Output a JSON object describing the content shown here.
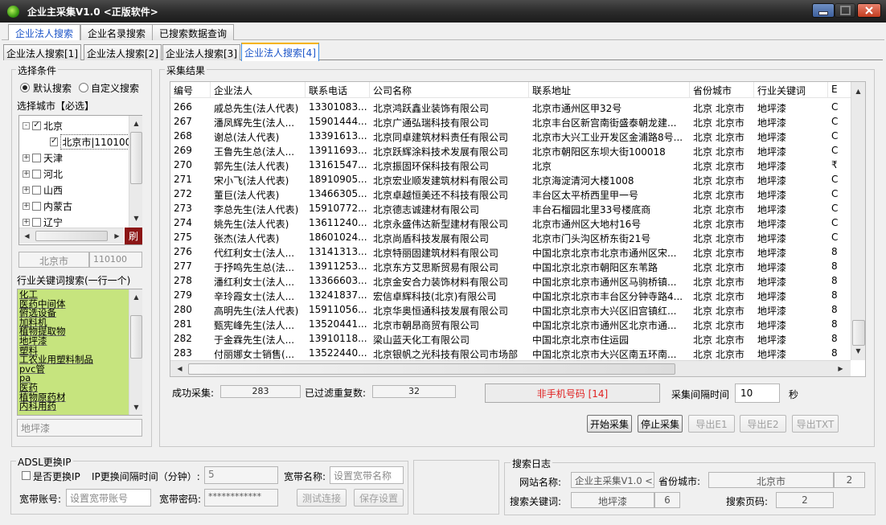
{
  "window": {
    "title": "企业主采集V1.0 <正版软件>"
  },
  "top_tabs": [
    "企业法人搜索",
    "企业名录搜索",
    "已搜索数据查询"
  ],
  "sub_tabs": [
    "企业法人搜索[1]",
    "企业法人搜索[2]",
    "企业法人搜索[3]",
    "企业法人搜索[4]"
  ],
  "conditions": {
    "group_title": "选择条件",
    "mode_default": "默认搜索",
    "mode_custom": "自定义搜索",
    "city_label": "选择城市【必选】",
    "tree": [
      {
        "label": "北京",
        "expander": "-",
        "checked": true,
        "child": false
      },
      {
        "label": "北京市|110100",
        "expander": "",
        "checked": true,
        "child": true
      },
      {
        "label": "天津",
        "expander": "+",
        "checked": false,
        "child": false
      },
      {
        "label": "河北",
        "expander": "+",
        "checked": false,
        "child": false
      },
      {
        "label": "山西",
        "expander": "+",
        "checked": false,
        "child": false
      },
      {
        "label": "内蒙古",
        "expander": "+",
        "checked": false,
        "child": false
      },
      {
        "label": "辽宁",
        "expander": "+",
        "checked": false,
        "child": false
      }
    ],
    "refresh_label": "刷",
    "selected_city": "北京市",
    "selected_code": "110100",
    "keyword_label": "行业关键词搜索(一行一个)",
    "keywords": [
      "化工",
      "医药中间体",
      "俯选设备",
      "加料机",
      "植物提取物",
      "地坪漆",
      "塑料",
      "工农业用塑料制品",
      "pvc管",
      "pa",
      "医药",
      "植物原药材",
      "内科用药"
    ],
    "keyword_input": "地坪漆"
  },
  "results": {
    "group_title": "采集结果",
    "columns": [
      "编号",
      "企业法人",
      "联系电话",
      "公司名称",
      "联系地址",
      "省份城市",
      "行业关键词",
      "E"
    ],
    "rows": [
      [
        "266",
        "戚总先生(法人代表)",
        "13301083...",
        "北京鸿跃鑫业装饰有限公司",
        "北京市通州区甲32号",
        "北京 北京市",
        "地坪漆",
        "C"
      ],
      [
        "267",
        "潘凤辉先生(法人...",
        "15901444...",
        "北京广通弘瑞科技有限公司",
        "北京丰台区新宫南街盛泰朝龙建...",
        "北京 北京市",
        "地坪漆",
        "C"
      ],
      [
        "268",
        "谢总(法人代表)",
        "13391613...",
        "北京同卓建筑材料责任有限公司",
        "北京市大兴工业开发区金浦路8号...",
        "北京 北京市",
        "地坪漆",
        "C"
      ],
      [
        "269",
        "王鲁先生总(法人...",
        "13911693...",
        "北京跃辉涂料技术发展有限公司",
        "北京市朝阳区东坝大街100018",
        "北京 北京市",
        "地坪漆",
        "C"
      ],
      [
        "270",
        "郭先生(法人代表)",
        "13161547...",
        "北京振固环保科技有限公司",
        "北京",
        "北京 北京市",
        "地坪漆",
        "₹"
      ],
      [
        "271",
        "宋小飞(法人代表)",
        "18910905...",
        "北京宏业顺发建筑材料有限公司",
        "北京海淀清河大楼1008",
        "北京 北京市",
        "地坪漆",
        "C"
      ],
      [
        "272",
        "董巨(法人代表)",
        "13466305...",
        "北京卓越恒美还不科技有限公司",
        "丰台区太平桥西里甲一号",
        "北京 北京市",
        "地坪漆",
        "C"
      ],
      [
        "273",
        "李总先生(法人代表)",
        "15910772...",
        "北京德志诚建材有限公司",
        "丰台石榴园北里33号楼底商",
        "北京 北京市",
        "地坪漆",
        "C"
      ],
      [
        "274",
        "姚先生(法人代表)",
        "13611240...",
        "北京永盛伟达新型建材有限公司",
        "北京市通州区大地村16号",
        "北京 北京市",
        "地坪漆",
        "C"
      ],
      [
        "275",
        "张杰(法人代表)",
        "18601024...",
        "北京尚盾科技发展有限公司",
        "北京市门头沟区桥东街21号",
        "北京 北京市",
        "地坪漆",
        "C"
      ],
      [
        "276",
        "代红利女士(法人...",
        "13141313...",
        "北京特丽固建筑材料有限公司",
        "中国北京北京市北京市通州区宋...",
        "北京 北京市",
        "地坪漆",
        "8"
      ],
      [
        "277",
        "于抒鸣先生总(法...",
        "13911253...",
        "北京东方艾思斯贸易有限公司",
        "中国北京北京市朝阳区东苇路",
        "北京 北京市",
        "地坪漆",
        "8"
      ],
      [
        "278",
        "潘红利女士(法人...",
        "13366603...",
        "北京金安合力装饰材料有限公司",
        "中国北京北京市通州区马驹桥镇...",
        "北京 北京市",
        "地坪漆",
        "8"
      ],
      [
        "279",
        "辛玲霞女士(法人...",
        "13241837...",
        "宏信卓辉科技(北京)有限公司",
        "中国北京北京市丰台区分钟寺路4...",
        "北京 北京市",
        "地坪漆",
        "8"
      ],
      [
        "280",
        "高明先生(法人代表)",
        "15911056...",
        "北京华奥恒通科技发展有限公司",
        "中国北京北京市大兴区旧宫镇红...",
        "北京 北京市",
        "地坪漆",
        "8"
      ],
      [
        "281",
        "甄宪峰先生(法人...",
        "13520441...",
        "北京市朝昂商贸有限公司",
        "中国北京北京市通州区北京市通...",
        "北京 北京市",
        "地坪漆",
        "8"
      ],
      [
        "282",
        "于金霖先生(法人...",
        "13910118...",
        "梁山蓝天化工有限公司",
        "中国北京北京市住运园",
        "北京 北京市",
        "地坪漆",
        "8"
      ],
      [
        "283",
        "付丽娜女士销售(...",
        "13522440...",
        "北京银帆之光科技有限公司市场部",
        "中国北京北京市大兴区南五环南...",
        "北京 北京市",
        "地坪漆",
        "8"
      ]
    ]
  },
  "stats": {
    "success_label": "成功采集:",
    "success_count": "283",
    "filtered_label": "已过滤重复数:",
    "filtered_count": "32",
    "nonmobile": "非手机号码 [14]",
    "interval_label": "采集间隔时间",
    "interval_value": "10",
    "interval_unit": "秒"
  },
  "actions": {
    "start": "开始采集",
    "stop": "停止采集",
    "export1": "导出E1",
    "export2": "导出E2",
    "export_txt": "导出TXT"
  },
  "adsl": {
    "group_title": "ADSL更换IP",
    "change_ip_label": "是否更换IP",
    "interval_label": "IP更换间隔时间（分钟）:",
    "interval_value": "5",
    "bb_name_label": "宽带名称:",
    "bb_name_placeholder": "设置宽带名称",
    "bb_account_label": "宽带账号:",
    "bb_account_placeholder": "设置宽带账号",
    "bb_password_label": "宽带密码:",
    "bb_password_value": "************",
    "test_button": "测试连接",
    "save_button": "保存设置"
  },
  "log": {
    "group_title": "搜索日志",
    "site_label": "网站名称:",
    "site_value": "企业主采集V1.0 <正",
    "province_label": "省份城市:",
    "province_value": "北京市",
    "province_count": "2",
    "keyword_label": "搜索关键词:",
    "keyword_value": "地坪漆",
    "keyword_count": "6",
    "page_label": "搜索页码:",
    "page_value": "2"
  },
  "colors": {
    "accent": "#1c55c8",
    "keyword_bg": "#c6e47e",
    "alert_text": "#e02020",
    "refresh_bg": "#8b1515"
  }
}
